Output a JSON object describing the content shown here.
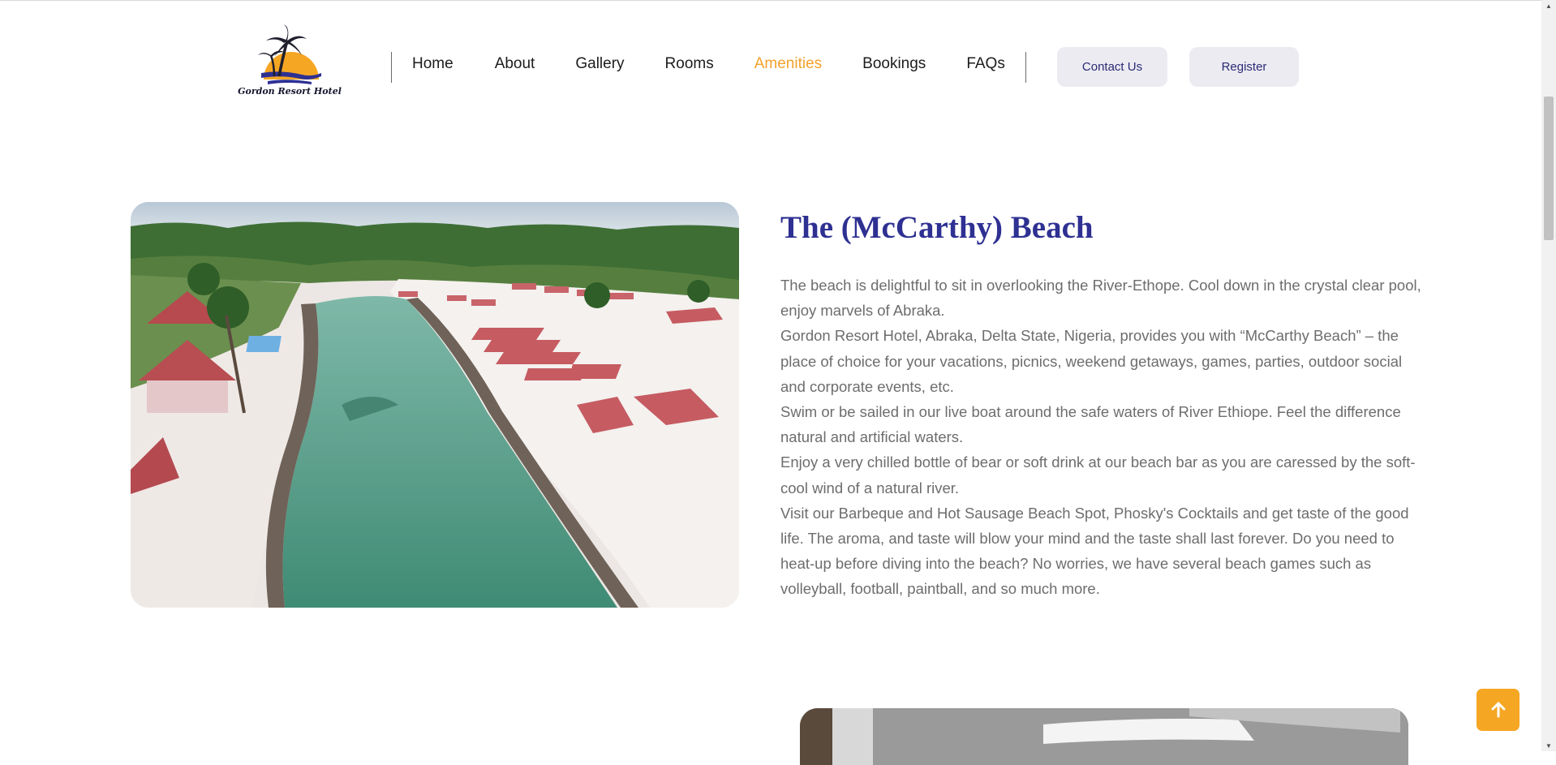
{
  "header": {
    "logo_text": "Gordon Resort Hotel",
    "nav": [
      "Home",
      "About",
      "Gallery",
      "Rooms",
      "Amenities",
      "Bookings",
      "FAQs"
    ],
    "active_nav": "Amenities",
    "contact_label": "Contact Us",
    "register_label": "Register"
  },
  "section": {
    "title": "The (McCarthy) Beach",
    "paragraphs": [
      "The beach is delightful to sit in overlooking the River-Ethope. Cool down in the crystal clear pool, enjoy marvels of Abraka.",
      "Gordon Resort Hotel, Abraka, Delta State, Nigeria, provides you with “McCarthy Beach” – the place of choice for your vacations, picnics, weekend getaways, games, parties, outdoor social and corporate events, etc.",
      "Swim or be sailed in our live boat around the safe waters of River Ethiope. Feel the difference natural and artificial waters.",
      "Enjoy a very chilled bottle of bear or soft drink at our beach bar as you are caressed by the soft-cool wind of a natural river.",
      "Visit our Barbeque and Hot Sausage Beach Spot, Phosky's Cocktails and get taste of the good life. The aroma, and taste will blow your mind and the taste shall last forever. Do you need to heat-up before diving into the beach? No worries, we have several beach games such as volleyball, football, paintball, and so much more."
    ]
  },
  "colors": {
    "accent": "#f4a12b",
    "title": "#2e3092",
    "button_bg": "#ecebf2",
    "button_text": "#2a2a74",
    "body_text": "#6d6d6d"
  },
  "icons": {
    "scroll_top": "arrow-up-icon",
    "logo": "palm-sunset-icon"
  }
}
